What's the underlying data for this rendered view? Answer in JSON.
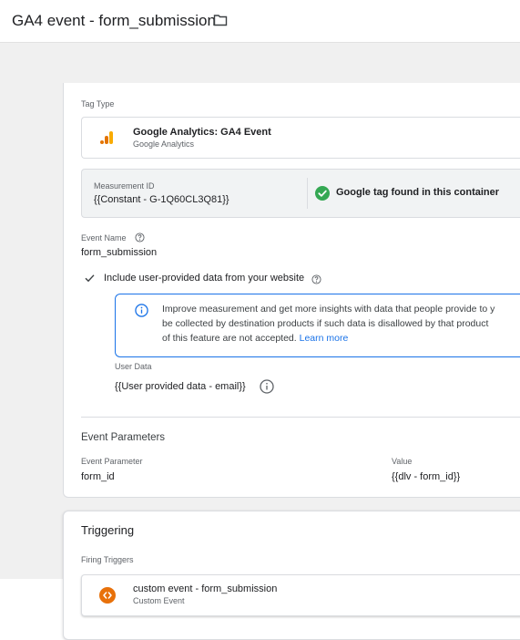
{
  "header": {
    "title": "GA4 event - form_submission"
  },
  "tag": {
    "tag_type_label": "Tag Type",
    "tag_name": "Google Analytics: GA4 Event",
    "tag_sub": "Google Analytics",
    "measurement_label": "Measurement ID",
    "measurement_value": "{{Constant - G-1Q60CL3Q81}}",
    "found_text": "Google tag found in this container",
    "event_name_label": "Event Name",
    "event_name_value": "form_submission",
    "include_label": "Include user-provided data from your website",
    "info_line1": "Improve measurement and get more insights with data that people provide to y",
    "info_line2": "be collected by destination products if such data is disallowed by that product",
    "info_line3": "of this feature are not accepted.",
    "learn_more": "Learn more",
    "user_data_label": "User Data",
    "user_data_value": "{{User provided data - email}}",
    "event_params_title": "Event Parameters",
    "param_col_label": "Event Parameter",
    "value_col_label": "Value",
    "param_name": "form_id",
    "param_value": "{{dlv - form_id}}"
  },
  "triggering": {
    "title": "Triggering",
    "firing_label": "Firing Triggers",
    "trigger_name": "custom event - form_submission",
    "trigger_sub": "Custom Event"
  },
  "colors": {
    "accent_blue": "#1a73e8",
    "success_green": "#34a853",
    "ga_orange": "#f9ab00",
    "trigger_orange": "#e8710a"
  }
}
